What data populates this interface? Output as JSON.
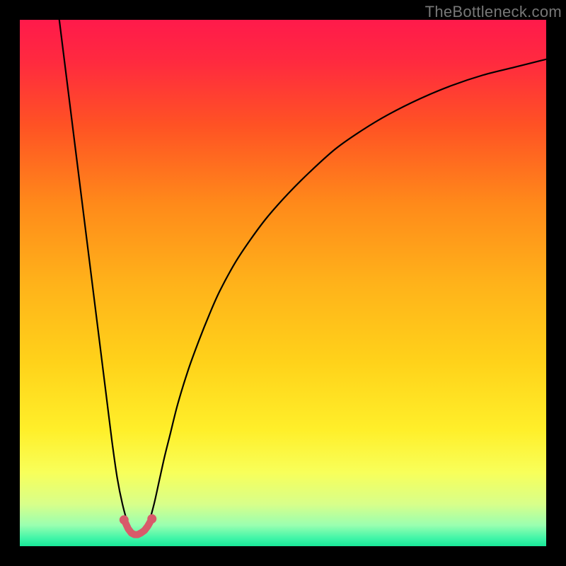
{
  "watermark": "TheBottleneck.com",
  "chart_data": {
    "type": "line",
    "title": "",
    "xlabel": "",
    "ylabel": "",
    "xlim": [
      0,
      100
    ],
    "ylim": [
      0,
      100
    ],
    "grid": false,
    "background_gradient": {
      "stops": [
        {
          "offset": 0.0,
          "color": "#ff1a4b"
        },
        {
          "offset": 0.08,
          "color": "#ff2a3f"
        },
        {
          "offset": 0.2,
          "color": "#ff5224"
        },
        {
          "offset": 0.35,
          "color": "#ff8a1a"
        },
        {
          "offset": 0.5,
          "color": "#ffb21a"
        },
        {
          "offset": 0.65,
          "color": "#ffd21a"
        },
        {
          "offset": 0.78,
          "color": "#ffef2a"
        },
        {
          "offset": 0.86,
          "color": "#f8ff5a"
        },
        {
          "offset": 0.92,
          "color": "#d8ff8a"
        },
        {
          "offset": 0.96,
          "color": "#9affb0"
        },
        {
          "offset": 0.985,
          "color": "#40f5a8"
        },
        {
          "offset": 1.0,
          "color": "#18e898"
        }
      ]
    },
    "series": [
      {
        "name": "bottleneck-curve",
        "stroke": "#000000",
        "stroke_width": 2.2,
        "x": [
          7.5,
          8.5,
          9.5,
          10.5,
          11.5,
          12.5,
          13.5,
          14.5,
          15.5,
          16.5,
          17.5,
          18.5,
          19.5,
          20.5,
          21.5,
          22.5,
          23.5,
          24.5,
          25.5,
          26.5,
          27.5,
          28.5,
          30,
          32,
          34,
          36,
          38,
          41,
          44,
          47,
          51,
          55,
          60,
          65,
          70,
          76,
          82,
          88,
          94,
          100
        ],
        "y": [
          100,
          92,
          84,
          76,
          68,
          60,
          52,
          44,
          36,
          28,
          20,
          13,
          8,
          4.5,
          2.8,
          2.3,
          2.8,
          4.5,
          8,
          12.5,
          17,
          21,
          27,
          33.5,
          39,
          44,
          48.5,
          54,
          58.5,
          62.5,
          67,
          71,
          75.5,
          79,
          82,
          85,
          87.5,
          89.5,
          91,
          92.5
        ]
      },
      {
        "name": "bottleneck-marker",
        "type": "scatter",
        "stroke": "#d85a6a",
        "fill": "#d85a6a",
        "stroke_width": 10,
        "x": [
          19.8,
          20.6,
          21.2,
          21.8,
          22.4,
          23.0,
          23.7,
          24.3,
          25.1
        ],
        "y": [
          5.0,
          3.3,
          2.5,
          2.2,
          2.2,
          2.5,
          3.0,
          3.8,
          5.2
        ]
      }
    ]
  }
}
